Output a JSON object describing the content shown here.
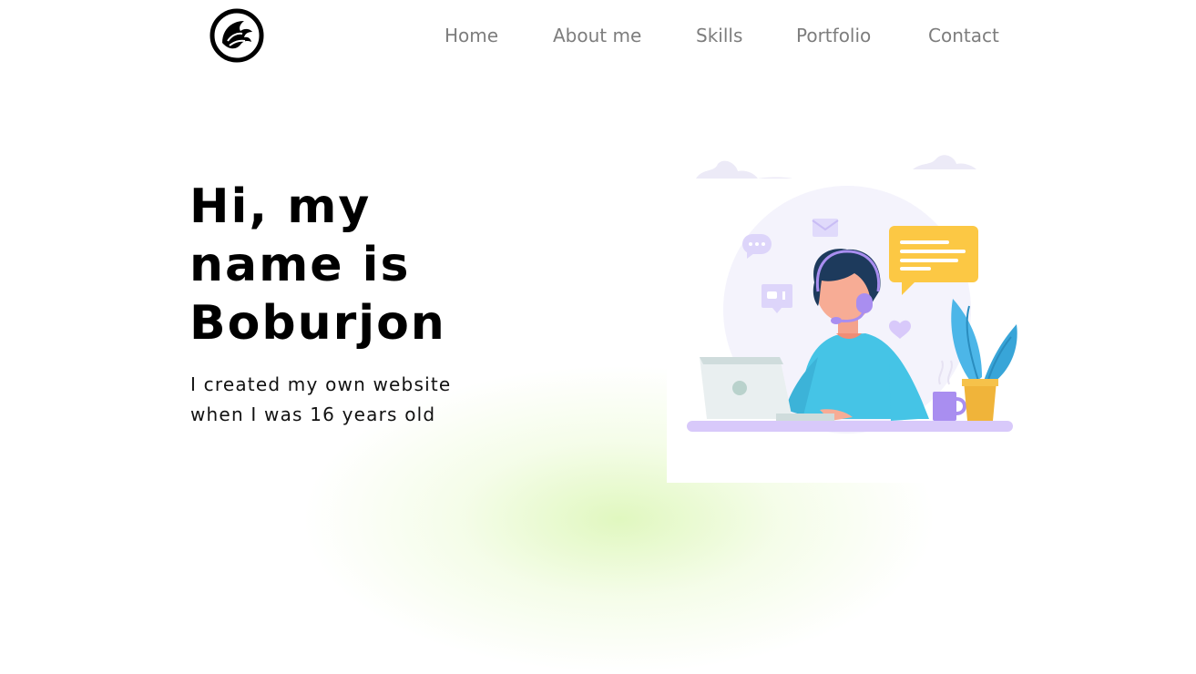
{
  "nav": {
    "items": [
      {
        "label": "Home"
      },
      {
        "label": "About me"
      },
      {
        "label": "Skills"
      },
      {
        "label": "Portfolio"
      },
      {
        "label": "Contact"
      }
    ]
  },
  "hero": {
    "title_line1": "Hi, my",
    "title_line2": "name is",
    "title_line3": "Boburjon",
    "subtitle_line1": "I created my own website",
    "subtitle_line2": "when I was 16 years old"
  },
  "icons": {
    "logo": "eagle-logo-icon",
    "illustration": "support-agent-illustration"
  },
  "colors": {
    "nav_text": "#7d7d7d",
    "title": "#000000",
    "shirt": "#45c4e6",
    "bubble_yellow": "#fcc844",
    "accent_purple": "#a98ef0",
    "plant": "#4cb6e8",
    "glow": "#d6f5aa"
  }
}
